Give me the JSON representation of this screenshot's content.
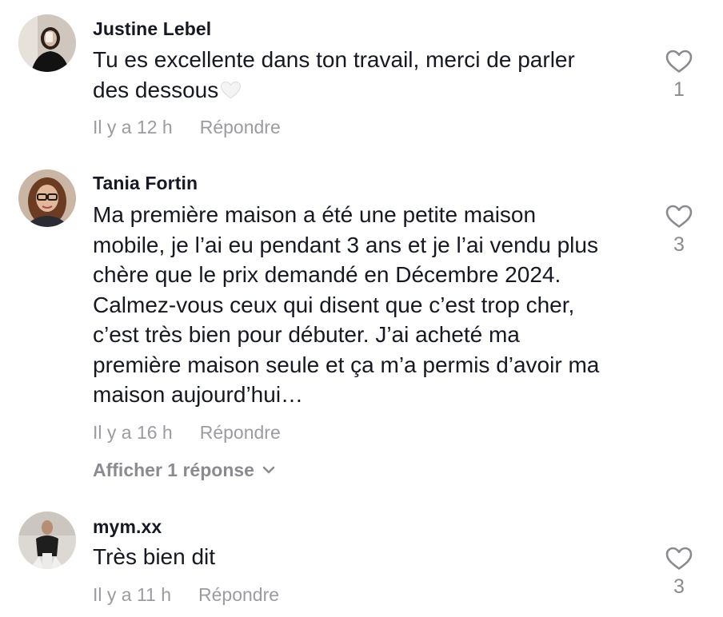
{
  "comments": [
    {
      "username": "Justine Lebel",
      "text": "Tu es excellente dans ton travail, merci de parler\ndes dessous",
      "emoji": "white-heart-emoji",
      "time": "Il y a 12 h",
      "reply_label": "Répondre",
      "likes": "1",
      "avatar": "avatar-justine"
    },
    {
      "username": "Tania Fortin",
      "text": "Ma première maison a été une petite maison\nmobile, je l’ai eu pendant 3 ans et je l’ai vendu plus\nchère que le prix demandé en Décembre 2024.\nCalmez-vous ceux qui disent que c’est trop cher,\nc’est très bien pour débuter. J’ai acheté ma\npremière maison seule et ça m’a permis d’avoir ma\nmaison aujourd’hui…",
      "time": "Il y a 16 h",
      "reply_label": "Répondre",
      "likes": "3",
      "view_replies": "Afficher 1 réponse",
      "avatar": "avatar-tania"
    },
    {
      "username": "mym.xx",
      "text": "Très bien dit",
      "time": "Il y a 11 h",
      "reply_label": "Répondre",
      "likes": "3",
      "avatar": "avatar-mym"
    }
  ],
  "icons": {
    "like": "heart-outline-icon",
    "expand": "chevron-down-icon"
  },
  "colors": {
    "text": "#161823",
    "meta": "#9b9ba1",
    "icon": "#8a8b91"
  }
}
